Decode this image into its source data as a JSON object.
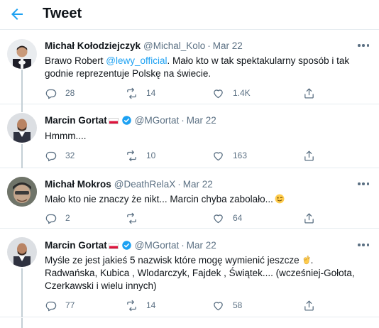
{
  "header": {
    "title": "Tweet"
  },
  "colors": {
    "accent": "#1da1f2",
    "secondary_text": "#5b7083",
    "thread_line": "#c4cfd6"
  },
  "tweets": [
    {
      "name": "Michał Kołodziejczyk",
      "handle": "@Michal_Kolo",
      "separator": "·",
      "date": "Mar 22",
      "text_before": "Brawo Robert ",
      "mention": "@lewy_official",
      "text_after": ". Mało kto w tak spektakularny sposób i tak godnie reprezentuje Polskę na świecie.",
      "replies": "28",
      "retweets": "14",
      "likes": "1.4K"
    },
    {
      "name": "Marcin Gortat",
      "verified": true,
      "flag": "poland-flag",
      "handle": "@MGortat",
      "separator": "·",
      "date": "Mar 22",
      "text": "Hmmm....",
      "replies": "32",
      "retweets": "10",
      "likes": "163"
    },
    {
      "name": "Michał Mokros",
      "handle": "@DeathRelaX",
      "separator": "·",
      "date": "Mar 22",
      "text": "Mało kto nie znaczy że nikt... Marcin chyba zabolało...",
      "emoji": "winking-face",
      "replies": "2",
      "retweets": "",
      "likes": "64"
    },
    {
      "name": "Marcin Gortat",
      "verified": true,
      "flag": "poland-flag",
      "handle": "@MGortat",
      "separator": "·",
      "date": "Mar 22",
      "text_before": "Myśle ze jest jakieś 5 nazwisk które mogę wymienić jeszcze",
      "emoji": "ok-hand",
      "text_after": ". Radwańska, Kubica , Wlodarczyk, Fajdek , Świątek.... (wcześniej-Gołota, Czerkawski i wielu innych)",
      "replies": "77",
      "retweets": "14",
      "likes": "58"
    }
  ]
}
